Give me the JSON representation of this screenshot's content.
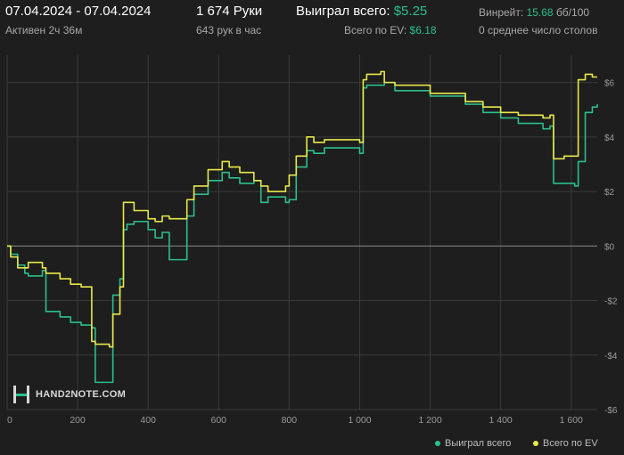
{
  "header": {
    "date_range": "07.04.2024 - 07.04.2024",
    "active": "Активен 2ч 36м",
    "hands": "1 674 Руки",
    "hands_per_hour": "643 рук в час",
    "won_label": "Выиграл всего:",
    "won_value": "$5.25",
    "ev_label": "Всего по EV:",
    "ev_value": "$6.18",
    "winrate_label": "Винрейт:",
    "winrate_value": "15.68",
    "winrate_unit": "бб/100",
    "tables": "0 среднее число столов"
  },
  "logo": {
    "text": "HAND2NOTE.COM"
  },
  "colors": {
    "won": "#2bbf8a",
    "ev": "#e8e84a",
    "bg": "#1e1e1e",
    "grid": "#3a3a3a",
    "zero": "#8a8a8a"
  },
  "chart_data": {
    "type": "line",
    "xlim": [
      0,
      1674
    ],
    "ylim": [
      -6,
      7
    ],
    "x_ticks": [
      0,
      200,
      400,
      600,
      800,
      1000,
      1200,
      1400,
      1600
    ],
    "x_tick_labels": [
      "0",
      "200",
      "400",
      "600",
      "800",
      "1 000",
      "1 200",
      "1 400",
      "1 600"
    ],
    "y_ticks": [
      -6,
      -4,
      -2,
      0,
      2,
      4,
      6
    ],
    "y_tick_labels": [
      "-$6",
      "-$4",
      "-$2",
      "$0",
      "$2",
      "$4",
      "$6"
    ],
    "grid": true,
    "legend": "bottom-right",
    "series": [
      {
        "name": "Выиграл всего",
        "color": "#2bbf8a",
        "x": [
          0,
          10,
          30,
          50,
          60,
          100,
          110,
          150,
          180,
          210,
          240,
          250,
          290,
          300,
          320,
          330,
          340,
          360,
          400,
          420,
          440,
          460,
          500,
          510,
          530,
          570,
          610,
          630,
          660,
          700,
          720,
          740,
          790,
          800,
          820,
          850,
          870,
          900,
          1000,
          1010,
          1020,
          1060,
          1070,
          1100,
          1200,
          1300,
          1350,
          1400,
          1450,
          1520,
          1540,
          1550,
          1580,
          1610,
          1620,
          1640,
          1660,
          1674
        ],
        "y": [
          0,
          -0.3,
          -0.7,
          -1.0,
          -1.1,
          -0.9,
          -2.4,
          -2.6,
          -2.8,
          -2.9,
          -3.0,
          -5.0,
          -5.0,
          -1.8,
          -1.2,
          0.6,
          0.8,
          0.9,
          0.6,
          0.3,
          0.5,
          -0.5,
          -0.5,
          1.1,
          1.9,
          2.4,
          2.7,
          2.5,
          2.3,
          2.4,
          1.6,
          1.8,
          1.6,
          1.7,
          2.9,
          3.5,
          3.4,
          3.6,
          3.4,
          5.8,
          5.9,
          5.9,
          6.0,
          5.7,
          5.5,
          5.2,
          4.9,
          4.7,
          4.5,
          4.3,
          4.4,
          2.3,
          2.3,
          2.2,
          3.1,
          4.9,
          5.1,
          5.2
        ]
      },
      {
        "name": "Всего по EV",
        "color": "#e8e84a",
        "x": [
          0,
          10,
          30,
          50,
          60,
          100,
          110,
          150,
          180,
          210,
          240,
          250,
          290,
          300,
          320,
          330,
          340,
          360,
          400,
          420,
          440,
          460,
          500,
          510,
          530,
          570,
          610,
          630,
          660,
          700,
          720,
          740,
          790,
          800,
          820,
          850,
          870,
          900,
          1000,
          1010,
          1020,
          1060,
          1070,
          1100,
          1200,
          1300,
          1350,
          1400,
          1450,
          1520,
          1540,
          1550,
          1580,
          1610,
          1620,
          1640,
          1660,
          1674
        ],
        "y": [
          0,
          -0.4,
          -0.8,
          -0.8,
          -0.6,
          -0.8,
          -1.0,
          -1.2,
          -1.4,
          -1.5,
          -3.5,
          -3.6,
          -3.7,
          -2.5,
          -1.5,
          1.6,
          1.6,
          1.3,
          1.0,
          0.9,
          1.1,
          1.0,
          1.0,
          1.7,
          2.2,
          2.8,
          3.1,
          2.9,
          2.7,
          2.4,
          2.2,
          2.0,
          2.2,
          2.6,
          3.3,
          4.0,
          3.8,
          3.9,
          3.8,
          6.1,
          6.3,
          6.4,
          6.0,
          5.9,
          5.6,
          5.3,
          5.1,
          4.9,
          4.8,
          4.7,
          4.8,
          3.2,
          3.3,
          3.3,
          6.1,
          6.3,
          6.2,
          6.2
        ]
      }
    ]
  }
}
